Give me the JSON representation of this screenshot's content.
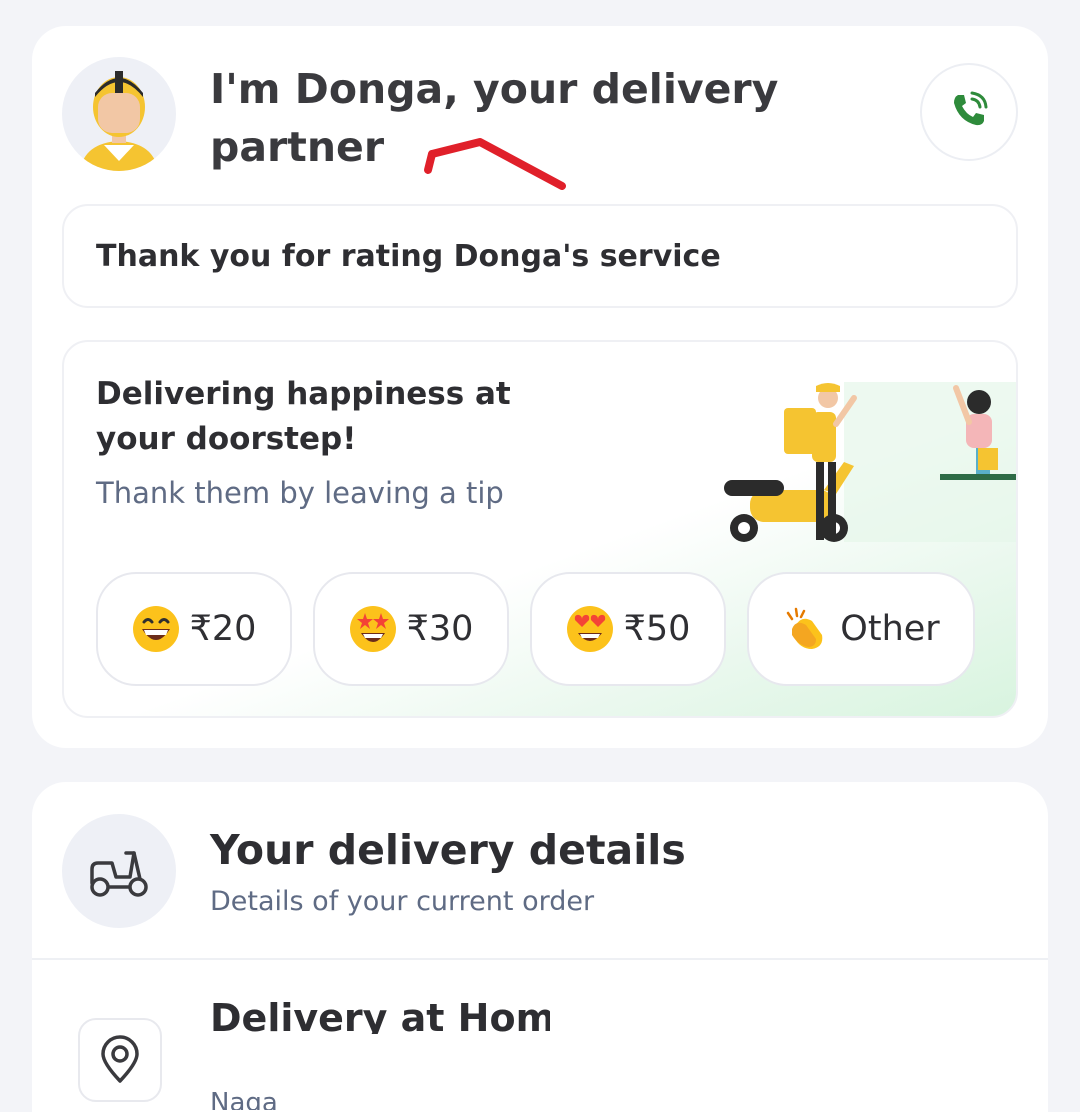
{
  "partner_card": {
    "title": "I'm Donga, your delivery partner",
    "rating_thanks": "Thank you for rating Donga's service",
    "icons": {
      "avatar": "delivery-partner-avatar",
      "call": "phone-call-icon"
    },
    "accent_color": "#2e8b3b"
  },
  "tip_section": {
    "heading": "Delivering happiness at your doorstep!",
    "subheading": "Thank them by leaving a tip",
    "options": [
      {
        "emoji": "grinning-face",
        "label": "₹20"
      },
      {
        "emoji": "star-struck-face",
        "label": "₹30"
      },
      {
        "emoji": "heart-eyes-face",
        "label": "₹50"
      },
      {
        "emoji": "clapping-hands",
        "label": "Other"
      }
    ]
  },
  "delivery_details": {
    "title": "Your delivery details",
    "subtitle": "Details of your current order",
    "address_title": "Delivery at Home",
    "address_line": "Naga",
    "icons": {
      "header": "scooter-icon",
      "address": "location-pin-icon"
    }
  }
}
